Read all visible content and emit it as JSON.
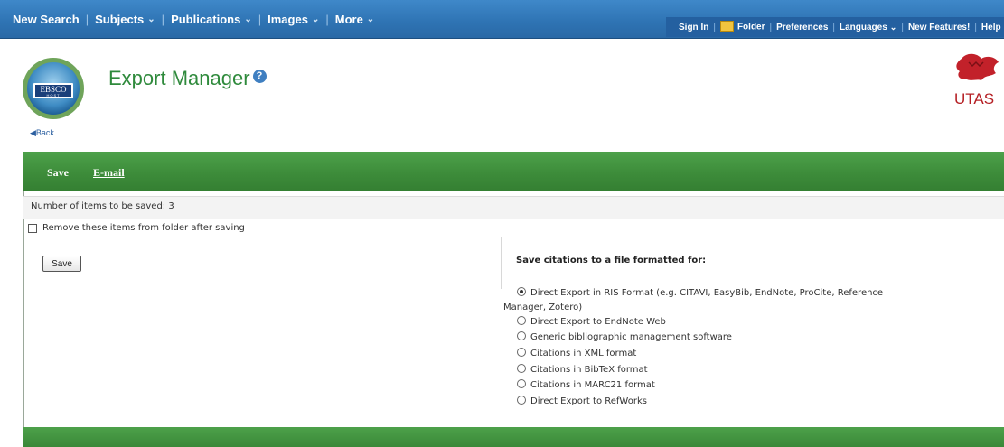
{
  "topnav": {
    "left": [
      {
        "label": "New Search",
        "chevron": false
      },
      {
        "label": "Subjects",
        "chevron": true
      },
      {
        "label": "Publications",
        "chevron": true
      },
      {
        "label": "Images",
        "chevron": true
      },
      {
        "label": "More",
        "chevron": true
      }
    ],
    "right": {
      "sign_in": "Sign In",
      "folder": "Folder",
      "preferences": "Preferences",
      "languages": "Languages",
      "new_features": "New Features!",
      "help": "Help"
    }
  },
  "header": {
    "logo_text": "EBSCO",
    "logo_subtext": "HOST",
    "title": "Export Manager",
    "help_icon_glyph": "?",
    "back_link": "Back",
    "institution_logo": "UTAS"
  },
  "toolbar": {
    "save_label": "Save",
    "email_label": "E-mail"
  },
  "count_text": "Number of items to be saved: 3",
  "remove_label": "Remove these items from folder after saving",
  "save_button_label": "Save",
  "format_section": {
    "title": "Save citations to a file formatted for:",
    "options": [
      {
        "label": "Direct Export in RIS Format (e.g. CITAVI, EasyBib, EndNote, ProCite, Reference Manager, Zotero)",
        "selected": true
      },
      {
        "label": "Direct Export to EndNote Web",
        "selected": false
      },
      {
        "label": "Generic bibliographic management software",
        "selected": false
      },
      {
        "label": "Citations in XML format",
        "selected": false
      },
      {
        "label": "Citations in BibTeX format",
        "selected": false
      },
      {
        "label": "Citations in MARC21 format",
        "selected": false
      },
      {
        "label": "Direct Export to RefWorks",
        "selected": false
      }
    ]
  },
  "colors": {
    "nav_blue": "#2e73b3",
    "toolbar_green": "#3d8c3a",
    "title_green": "#2f8a3c",
    "utas_red": "#b51f24"
  }
}
